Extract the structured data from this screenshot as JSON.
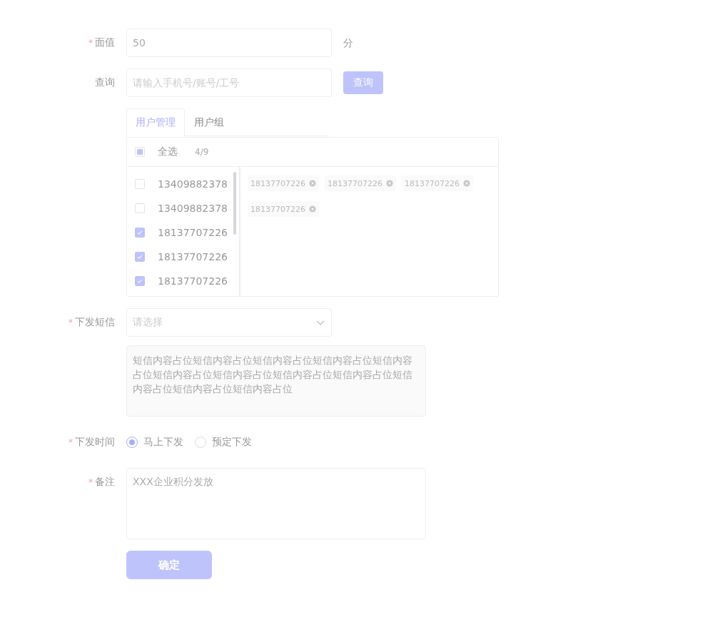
{
  "face_value": {
    "label": "面值",
    "required_mark": "*",
    "value": "50",
    "unit": "分"
  },
  "query": {
    "label": "查询",
    "placeholder": "请输入手机号/账号/工号",
    "button": "查询"
  },
  "tabs": [
    {
      "label": "用户管理",
      "selected": true
    },
    {
      "label": "用户组",
      "selected": false
    }
  ],
  "transfer": {
    "select_all": {
      "label": "全选",
      "checked": false,
      "indeterminate": true
    },
    "count": "4/9",
    "items": [
      {
        "label": "13409882378",
        "checked": false
      },
      {
        "label": "13409882378",
        "checked": false
      },
      {
        "label": "18137707226",
        "checked": true
      },
      {
        "label": "18137707226",
        "checked": true
      },
      {
        "label": "18137707226",
        "checked": true
      }
    ],
    "tags": [
      "18137707226",
      "18137707226",
      "18137707226",
      "18137707226"
    ]
  },
  "sms": {
    "label": "下发短信",
    "required_mark": "*",
    "placeholder": "请选择",
    "content": "短信内容占位短信内容占位短信内容占位短信内容占位短信内容占位短信内容占位短信内容占位短信内容占位短信内容占位短信内容占位短信内容占位短信内容占位"
  },
  "send_time": {
    "label": "下发时间",
    "required_mark": "*",
    "options": [
      {
        "label": "马上下发",
        "selected": true
      },
      {
        "label": "预定下发",
        "selected": false
      }
    ]
  },
  "remark": {
    "label": "备注",
    "required_mark": "*",
    "value": "XXX企业积分发放"
  },
  "submit": "确定"
}
